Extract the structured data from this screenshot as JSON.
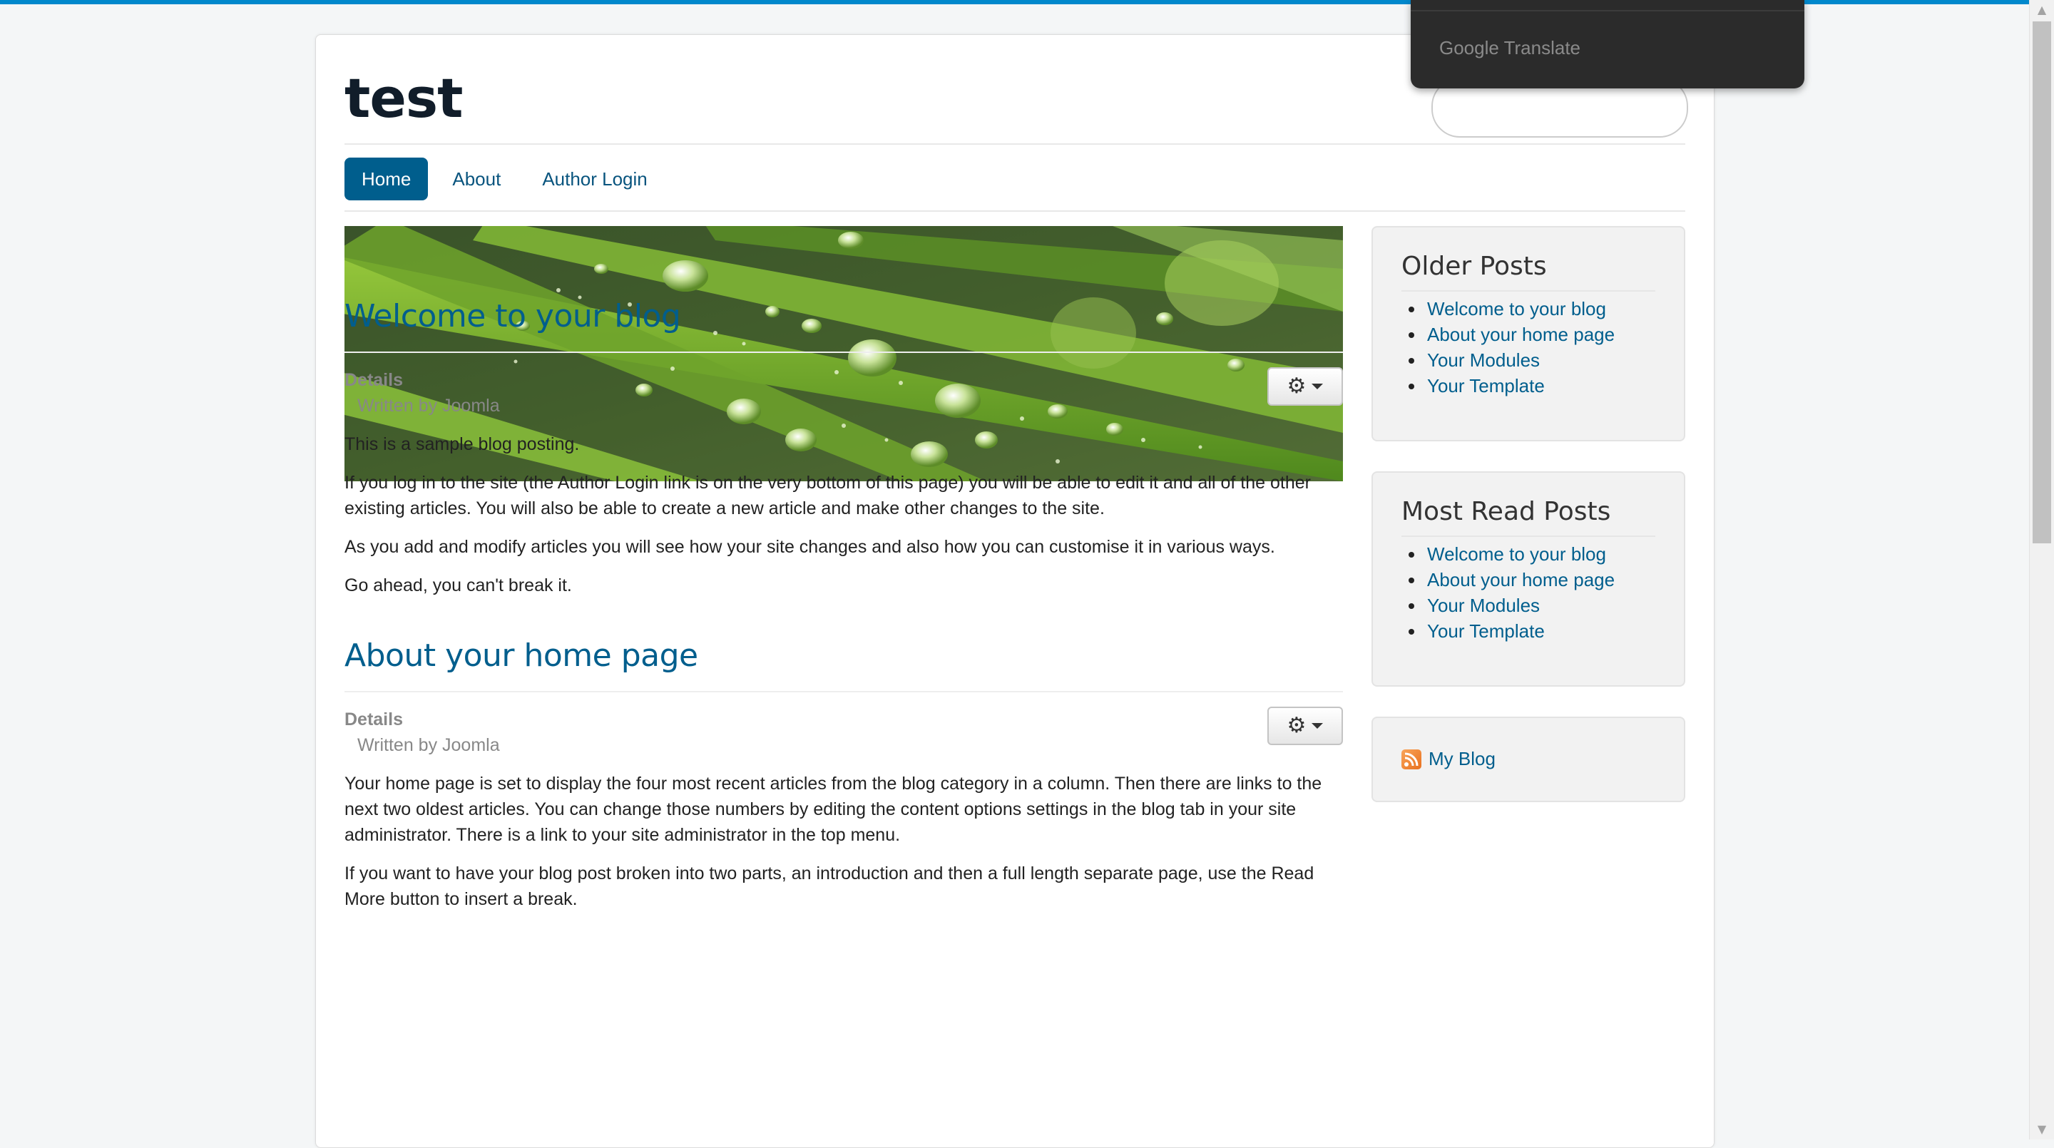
{
  "site": {
    "title": "test"
  },
  "nav": {
    "items": [
      "Home",
      "About",
      "Author Login"
    ]
  },
  "banner": {
    "icon": "water-droplets-on-grass-image"
  },
  "articles": [
    {
      "title": "Welcome to your blog",
      "details_label": "Details",
      "author": "Written by Joomla",
      "paragraphs": [
        "This is a sample blog posting.",
        "If you log in to the site (the Author Login link is on the very bottom of this page) you will be able to edit it and all of the other existing articles. You will also be able to create a new article and make other changes to the site.",
        "As you add and modify articles you will see how your site changes and also how you can customise it in various ways.",
        "Go ahead, you can't break it."
      ]
    },
    {
      "title": "About your home page",
      "details_label": "Details",
      "author": "Written by Joomla",
      "paragraphs": [
        "Your home page is set to display the four most recent articles from the blog category in a column. Then there are links to the next two oldest articles. You can change those numbers by editing the content options settings in the blog tab in your site administrator. There is a link to your site administrator in the top menu.",
        "If you want to have your blog post broken into two parts, an introduction and then a full length separate page, use the Read More button to insert a break."
      ]
    }
  ],
  "sidebar": {
    "older_posts": {
      "title": "Older Posts",
      "items": [
        "Welcome to your blog",
        "About your home page",
        "Your Modules",
        "Your Template"
      ]
    },
    "most_read": {
      "title": "Most Read Posts",
      "items": [
        "Welcome to your blog",
        "About your home page",
        "Your Modules",
        "Your Template"
      ]
    },
    "feed": {
      "label": "My Blog",
      "icon": "rss-feed-icon"
    }
  },
  "translate_popup": {
    "label": "Google Translate"
  },
  "colors": {
    "accent": "#005e8d",
    "link": "#08547e",
    "topbar": "#0088cc"
  }
}
